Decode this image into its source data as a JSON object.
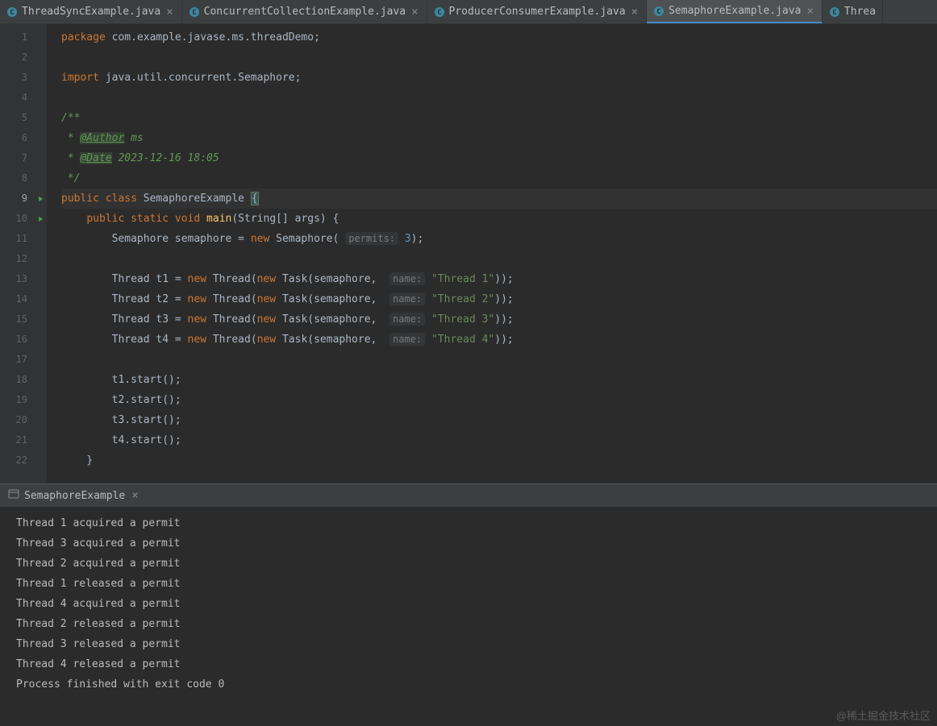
{
  "tabs": [
    {
      "label": "ThreadSyncExample.java",
      "active": false
    },
    {
      "label": "ConcurrentCollectionExample.java",
      "active": false
    },
    {
      "label": "ProducerConsumerExample.java",
      "active": false
    },
    {
      "label": "SemaphoreExample.java",
      "active": true
    },
    {
      "label": "Threa",
      "active": false,
      "cut": true
    }
  ],
  "code": {
    "package_kw": "package",
    "package_name": " com.example.javase.ms.threadDemo;",
    "import_kw": "import",
    "import_name": " java.util.concurrent.Semaphore;",
    "doc_open": "/**",
    "doc_author_prefix": " * ",
    "doc_author_tag": "@Author",
    "doc_author_val": " ms",
    "doc_date_prefix": " * ",
    "doc_date_tag": "@Date",
    "doc_date_val": " 2023-12-16 18:05",
    "doc_close": " */",
    "public_kw": "public",
    "class_kw": "class",
    "class_name": "SemaphoreExample",
    "static_kw": "static",
    "void_kw": "void",
    "main_fn": "main",
    "main_params": "(String[] args) {",
    "sem_decl": "        Semaphore semaphore = ",
    "new_kw": "new",
    "sem_ctor": " Semaphore( ",
    "permits_hint": "permits:",
    "permits_val": " 3",
    "sem_close": ");",
    "threads": [
      {
        "var": "t1",
        "name_str": "\"Thread 1\""
      },
      {
        "var": "t2",
        "name_str": "\"Thread 2\""
      },
      {
        "var": "t3",
        "name_str": "\"Thread 3\""
      },
      {
        "var": "t4",
        "name_str": "\"Thread 4\""
      }
    ],
    "thread_prefix": "        Thread ",
    "thread_assign": " = ",
    "thread_ctor": " Thread(",
    "task_ctor": " Task(semaphore,  ",
    "name_hint": "name:",
    "thread_close": "));",
    "start_calls": [
      "        t1.start();",
      "        t2.start();",
      "        t3.start();",
      "        t4.start();"
    ],
    "method_close": "    }"
  },
  "console": {
    "tab_label": "SemaphoreExample",
    "output": [
      "Thread 1 acquired a permit",
      "Thread 3 acquired a permit",
      "Thread 2 acquired a permit",
      "Thread 1 released a permit",
      "Thread 4 acquired a permit",
      "Thread 2 released a permit",
      "Thread 3 released a permit",
      "Thread 4 released a permit",
      "",
      "Process finished with exit code 0"
    ]
  },
  "watermark": "@稀土掘金技术社区"
}
